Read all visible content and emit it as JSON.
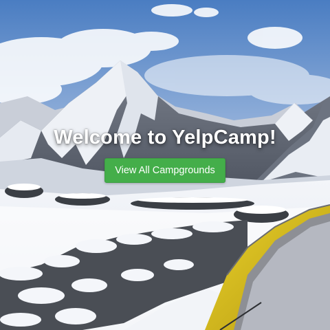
{
  "hero": {
    "title": "Welcome to YelpCamp!",
    "button_label": "View All Campgrounds",
    "background_description_icon": "mountain-camp-background"
  },
  "colors": {
    "button_bg": "#44ae4a",
    "title_text": "#ffffff",
    "sky_top": "#4f7fc0",
    "tent_yellow": "#d9c21c"
  }
}
